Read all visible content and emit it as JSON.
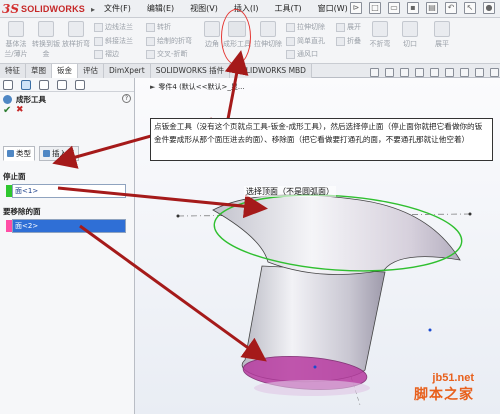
{
  "app": {
    "logo_ds": "3S",
    "logo_text": "SOLIDWORKS"
  },
  "menu": [
    "文件(F)",
    "编辑(E)",
    "视图(V)",
    "插入(I)",
    "工具(T)",
    "窗口(W)"
  ],
  "ribbon": {
    "left_buttons": [
      "基体法兰/薄片",
      "转换到钣金",
      "放样折弯"
    ],
    "edge_group": [
      "边线法兰",
      "斜接法兰",
      "褶边"
    ],
    "bend_group": [
      "转折",
      "绘制的折弯",
      "交叉-折断"
    ],
    "corner_label": "边角",
    "form_tool_label": "成形工具",
    "extrude_cut_label": "拉伸切除",
    "right_group1": [
      "拉伸切除",
      "简单直孔",
      "通风口"
    ],
    "unfold_group": [
      "展开",
      "折叠"
    ],
    "no_bend_label": "不折弯",
    "cut_label": "切口",
    "flatten_label": "展平"
  },
  "tabs": [
    "特征",
    "草图",
    "钣金",
    "评估",
    "DimXpert",
    "SOLIDWORKS 插件",
    "SOLIDWORKS MBD"
  ],
  "active_tab": "钣金",
  "breadcrumb": {
    "doc": "零件4 (默认<<默认>_显..."
  },
  "property_manager": {
    "title": "成形工具",
    "help": "?",
    "subtabs": [
      "类型",
      "插入点"
    ],
    "stop_face": {
      "heading": "停止面",
      "item": "面<1>",
      "swatch_color": "#2fc72f"
    },
    "remove_faces": {
      "heading": "要移除的面",
      "item": "面<2>",
      "swatch_color": "#ff4da6"
    }
  },
  "annotations": {
    "note": "点钣金工具（没有这个页就点工具-钣金-成形工具），然后选择停止面（停止面你就把它看做你的钣金件要成形从那个面压进去的面）、移除面（把它看做要打通孔的面，不要通孔那就让他空着）",
    "top_face_label": "选择顶面（不是圆弧面）",
    "annotation_color": "#a51a1a"
  },
  "watermark": {
    "url": "jb51.net",
    "name": "脚本之家"
  }
}
